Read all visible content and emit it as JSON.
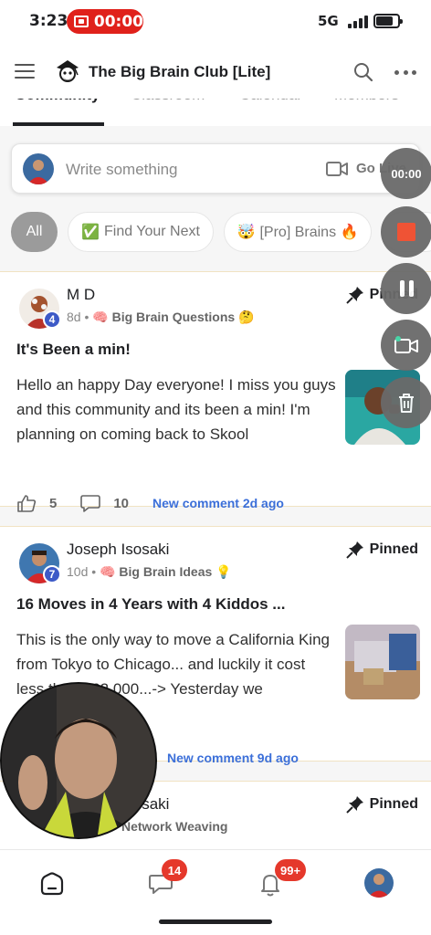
{
  "status_bar": {
    "time": "3:23",
    "recording_time": "00:00",
    "network": "5G"
  },
  "header": {
    "group_name": "The Big Brain Club [Lite]"
  },
  "tabs": [
    {
      "label": "Community",
      "active": true
    },
    {
      "label": "Classroom",
      "active": false
    },
    {
      "label": "Calendar",
      "active": false
    },
    {
      "label": "Members",
      "active": false
    }
  ],
  "composer": {
    "placeholder": "Write something",
    "go_live_label": "Go Live"
  },
  "filters": [
    {
      "label": "All",
      "emoji": "",
      "active": true
    },
    {
      "label": "Find Your Next",
      "emoji": "✅",
      "active": false
    },
    {
      "label": "[Pro] Brains 🔥",
      "emoji": "🤯",
      "active": false
    }
  ],
  "posts": [
    {
      "author": "M D",
      "level": "4",
      "age": "8d",
      "category": "Big Brain Questions",
      "category_emoji_pre": "🧠",
      "category_emoji_post": "🤔",
      "pinned_label": "Pinned",
      "title": "It's Been a min!",
      "body": "Hello an happy Day everyone! I miss you guys and this community and its been a min! I'm planning on coming back to Skool",
      "likes": "5",
      "comments": "10",
      "new_comment": "New comment 2d ago"
    },
    {
      "author": "Joseph Isosaki",
      "level": "7",
      "age": "10d",
      "category": "Big Brain Ideas",
      "category_emoji_pre": "🧠",
      "category_emoji_post": "💡",
      "pinned_label": "Pinned",
      "title": "16 Moves in 4 Years with 4 Kiddos ...",
      "body": "This is the only way to move a California King from Tokyo to Chicago... and luckily it cost less than $62,000...-> Yesterday we",
      "new_comment": "New comment 9d ago"
    },
    {
      "author": "Joseph Isosaki",
      "category": "Network Weaving",
      "pinned_label": "Pinned"
    }
  ],
  "recorder": {
    "timer": "00:00"
  },
  "bottom_nav": {
    "chat_badge": "14",
    "notifications_badge": "99+"
  },
  "colors": {
    "record_red": "#e0211b",
    "badge_red": "#e5382b",
    "link_blue": "#3b6fd9",
    "level_blue": "#3d5ac7"
  }
}
